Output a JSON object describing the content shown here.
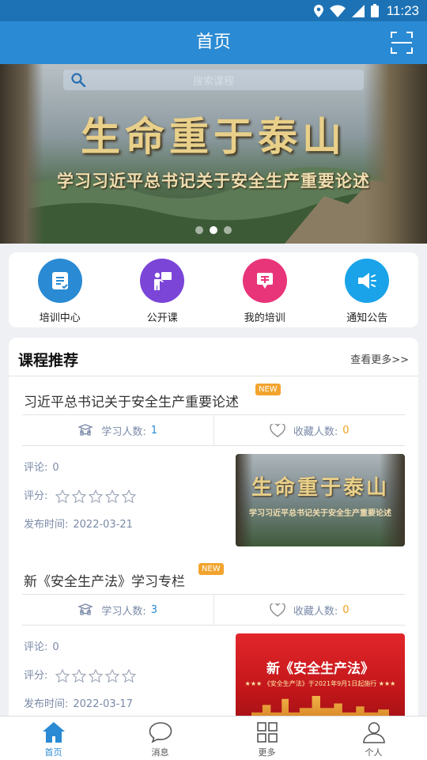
{
  "status_bar": {
    "time": "11:23",
    "icons": [
      "location-icon",
      "wifi-icon",
      "signal-icon",
      "battery-icon"
    ]
  },
  "app_bar": {
    "title": "首页",
    "right_icon": "scan-icon"
  },
  "banner": {
    "search_placeholder": "搜索课程",
    "headline": "生命重于泰山",
    "subheadline": "学习习近平总书记关于安全生产重要论述",
    "slide_count": 3,
    "active_slide": 2
  },
  "menu": {
    "items": [
      {
        "label": "培训中心",
        "icon": "training-center-icon",
        "color": "#2a8ad3"
      },
      {
        "label": "公开课",
        "icon": "open-class-icon",
        "color": "#7b45d8"
      },
      {
        "label": "我的培训",
        "icon": "my-training-icon",
        "color": "#e8357a"
      },
      {
        "label": "通知公告",
        "icon": "announcement-icon",
        "color": "#1aa3e8"
      }
    ]
  },
  "recommend": {
    "title": "课程推荐",
    "more": "查看更多>>",
    "courses": [
      {
        "title": "习近平总书记关于安全生产重要论述",
        "badge": "NEW",
        "learners_label": "学习人数:",
        "learners": "1",
        "favorites_label": "收藏人数:",
        "favorites": "0",
        "comments_label": "评论:",
        "comments": "0",
        "rating_label": "评分:",
        "rating": 0,
        "published_label": "发布时间:",
        "published": "2022-03-21",
        "thumb_title": "生命重于泰山",
        "thumb_subtitle": "学习习近平总书记关于安全生产重要论述"
      },
      {
        "title": "新《安全生产法》学习专栏",
        "badge": "NEW",
        "learners_label": "学习人数:",
        "learners": "3",
        "favorites_label": "收藏人数:",
        "favorites": "0",
        "comments_label": "评论:",
        "comments": "0",
        "rating_label": "评分:",
        "rating": 0,
        "published_label": "发布时间:",
        "published": "2022-03-17",
        "thumb_title": "新《安全生产法》",
        "thumb_subtitle": "★★★ 《安全生产法》于2021年9月1日起施行 ★★★"
      }
    ]
  },
  "tab_bar": {
    "tabs": [
      {
        "label": "首页",
        "icon": "home-icon",
        "active": true
      },
      {
        "label": "消息",
        "icon": "message-icon",
        "active": false
      },
      {
        "label": "更多",
        "icon": "grid-icon",
        "active": false
      },
      {
        "label": "个人",
        "icon": "user-icon",
        "active": false
      }
    ]
  }
}
